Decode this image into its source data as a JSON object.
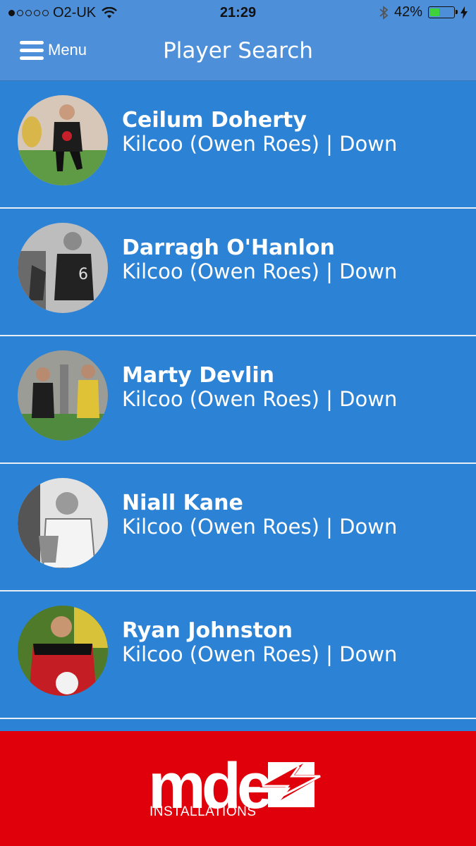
{
  "status_bar": {
    "carrier": "O2-UK",
    "time": "21:29",
    "battery_percent": "42%",
    "battery_level": 0.42,
    "signal_bars_filled": 1,
    "signal_bars_total": 5,
    "icons": [
      "wifi-icon",
      "bluetooth-icon",
      "battery-icon",
      "charging-bolt-icon"
    ]
  },
  "nav": {
    "menu_label": "Menu",
    "title": "Player Search"
  },
  "players": [
    {
      "name": "Ceilum Doherty",
      "club": "Kilcoo (Owen Roes) | Down"
    },
    {
      "name": "Darragh O'Hanlon",
      "club": "Kilcoo (Owen Roes) | Down"
    },
    {
      "name": "Marty Devlin",
      "club": "Kilcoo (Owen Roes) | Down"
    },
    {
      "name": "Niall Kane",
      "club": "Kilcoo (Owen Roes) | Down"
    },
    {
      "name": "Ryan Johnston",
      "club": "Kilcoo (Owen Roes) | Down"
    }
  ],
  "banner": {
    "logo_text": "mde",
    "logo_subtext": "INSTALLATIONS"
  },
  "colors": {
    "list_background": "#2c82d4",
    "nav_background": "#4d8fd9",
    "banner_background": "#e0000b",
    "battery_fill": "#3fd23a"
  }
}
